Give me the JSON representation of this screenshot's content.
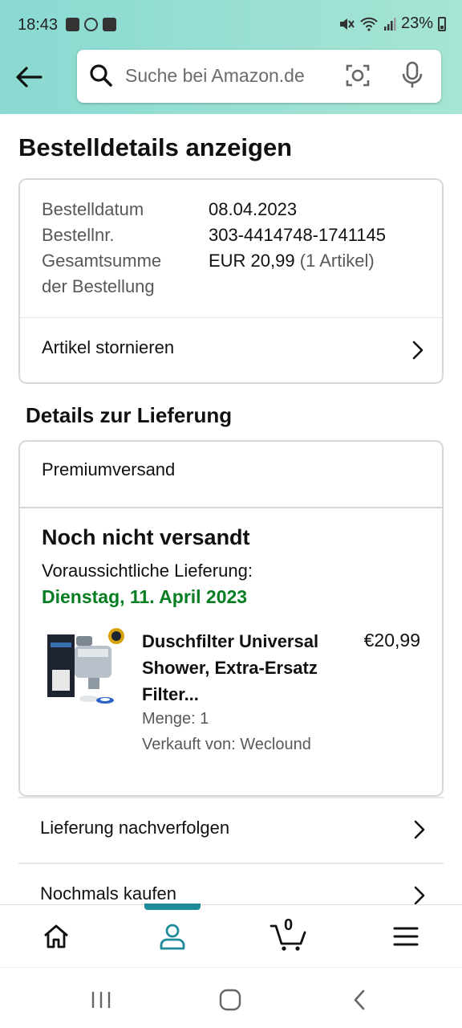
{
  "status_bar": {
    "time": "18:43",
    "battery": "23%"
  },
  "header": {
    "search_placeholder": "Suche bei Amazon.de"
  },
  "page": {
    "title": "Bestelldetails anzeigen"
  },
  "order": {
    "date_label": "Bestelldatum",
    "date_value": "08.04.2023",
    "number_label": "Bestellnr.",
    "number_value": "303-4414748-1741145",
    "total_label_line1": "Gesamtsumme",
    "total_label_line2": "der Bestellung",
    "total_value": "EUR 20,99",
    "total_items": "(1 Artikel)",
    "cancel_label": "Artikel stornieren"
  },
  "delivery": {
    "section_title": "Details zur Lieferung",
    "shipping_type": "Premiumversand",
    "status": "Noch nicht versandt",
    "estimate_label": "Voraussichtliche Lieferung:",
    "estimate_date": "Dienstag, 11. April 2023",
    "product": {
      "name": "Duschfilter Universal Shower, Extra-Ersatz Filter...",
      "price": "€20,99",
      "quantity": "Menge: 1",
      "seller": "Verkauft von: Weclound"
    }
  },
  "links": {
    "track": "Lieferung nachverfolgen",
    "buy_again": "Nochmals kaufen"
  },
  "bottom_nav": {
    "items": [
      "home-icon",
      "account-icon",
      "cart-icon",
      "menu-icon"
    ],
    "cart_count": "0",
    "active": "account",
    "accent_color": "#1f8a99"
  },
  "colors": {
    "header_gradient_start": "#89d9d2",
    "header_gradient_end": "#a6e5d3",
    "delivery_date_green": "#067d22"
  }
}
